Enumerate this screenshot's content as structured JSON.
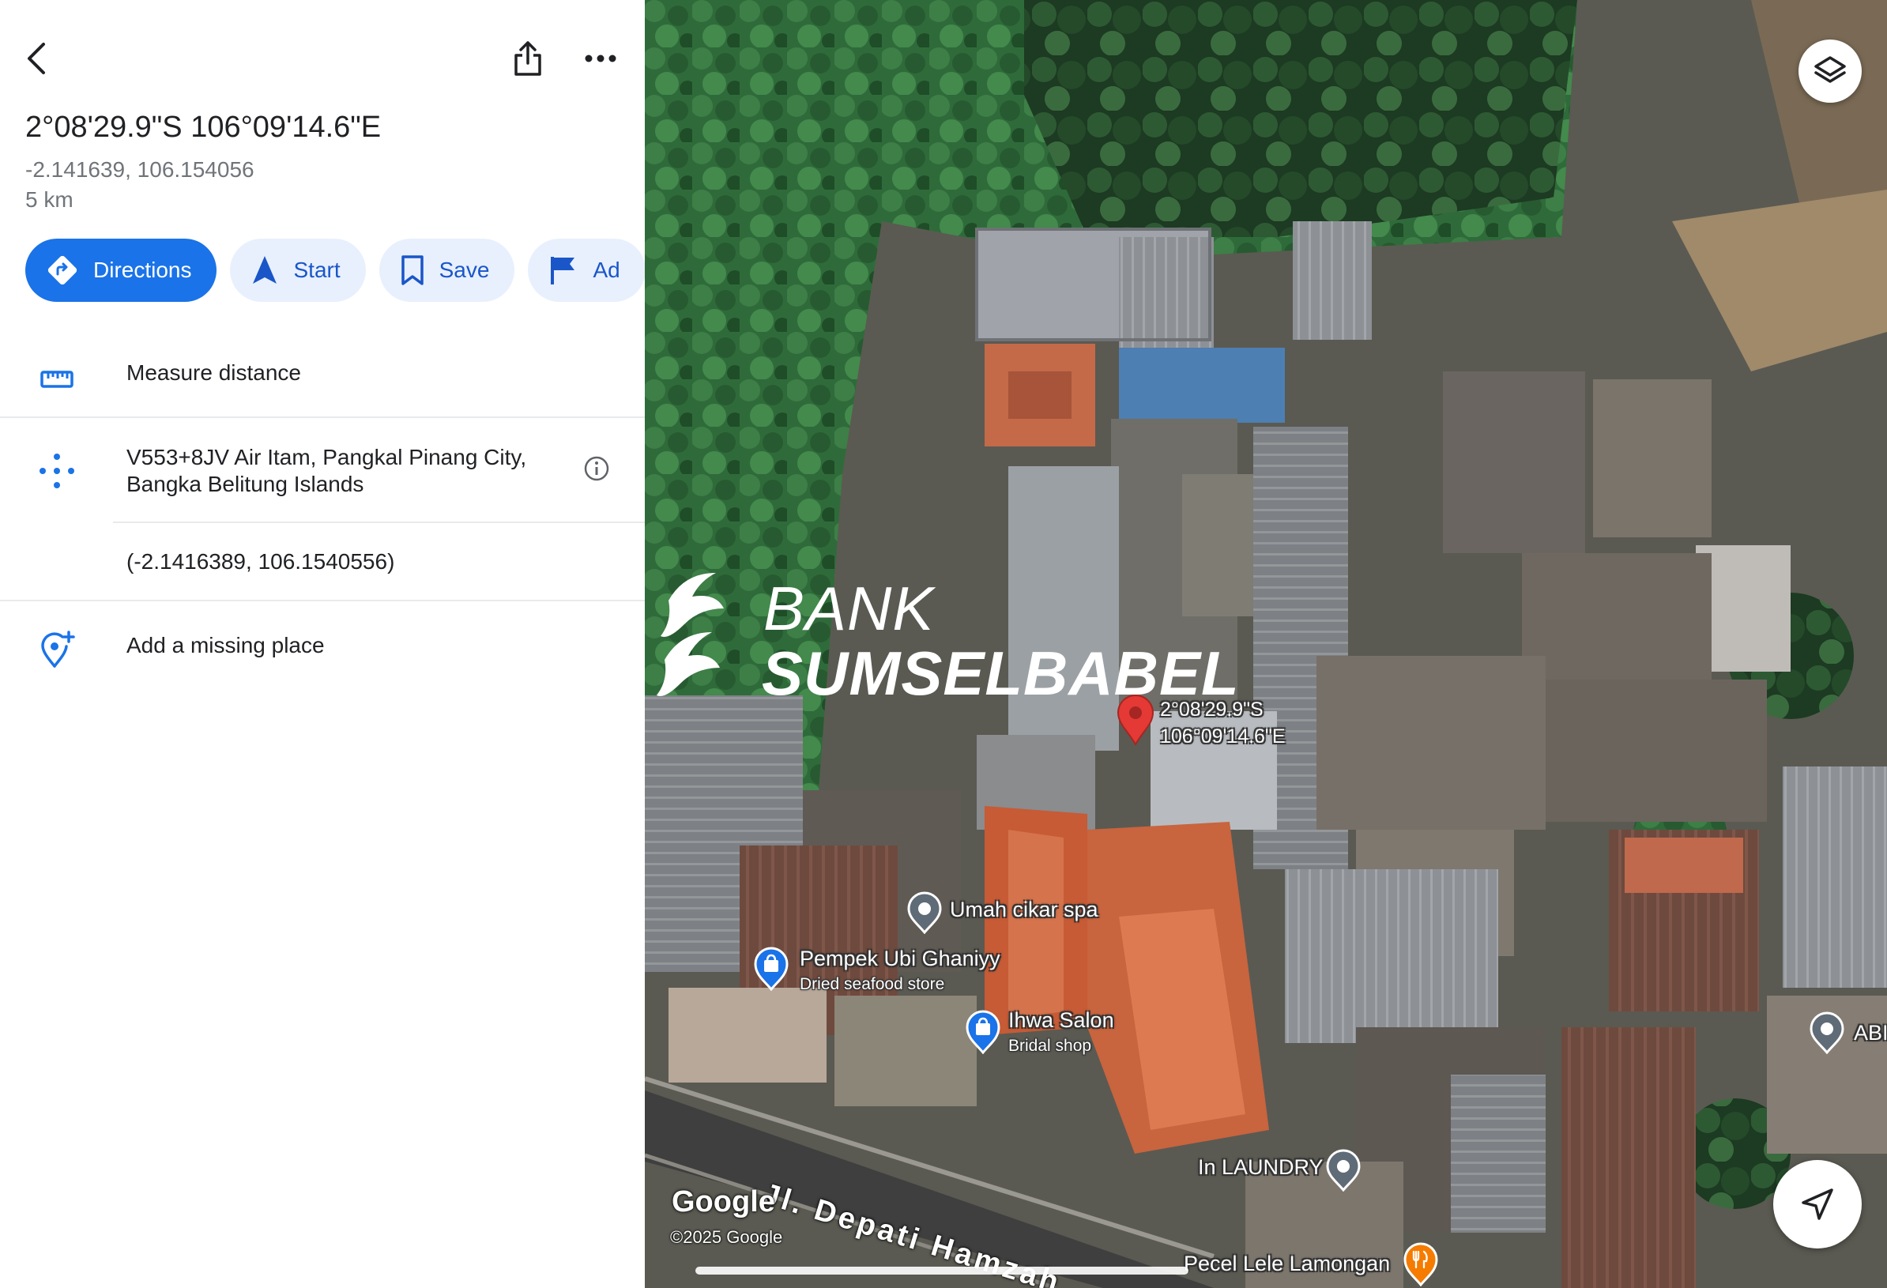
{
  "header": {
    "title": "2°08'29.9\"S 106°09'14.6\"E",
    "decimal_coords": "-2.141639, 106.154056",
    "distance": "5 km"
  },
  "actions": [
    {
      "label": "Directions",
      "icon": "directions-icon"
    },
    {
      "label": "Start",
      "icon": "navigation-arrow-icon"
    },
    {
      "label": "Save",
      "icon": "bookmark-icon"
    },
    {
      "label": "Ad",
      "icon": "flag-icon"
    }
  ],
  "rows": {
    "measure": {
      "label": "Measure distance",
      "icon": "ruler-icon"
    },
    "plus_code": {
      "address": "V553+8JV Air Itam, Pangkal Pinang City, Bangka Belitung Islands",
      "icon": "plus-code-icon"
    },
    "precise_coords": "(-2.1416389, 106.1540556)",
    "add_place": {
      "label": "Add a missing place",
      "icon": "add-location-icon"
    }
  },
  "map": {
    "watermark_line1": "BANK",
    "watermark_line2": "SUMSELBABEL",
    "pin_label_line1": "2°08'29.9\"S",
    "pin_label_line2": "106°09'14.6\"E",
    "places": [
      {
        "name": "Umah cikar spa",
        "category": "",
        "icon": "place-pin-icon"
      },
      {
        "name": "Pempek Ubi Ghaniyy",
        "category": "Dried seafood store",
        "icon": "shopping-bag-pin-icon"
      },
      {
        "name": "Ihwa Salon",
        "category": "Bridal shop",
        "icon": "shopping-bag-pin-icon"
      },
      {
        "name": "In LAUNDRY",
        "category": "",
        "icon": "place-pin-icon"
      },
      {
        "name": "Pecel Lele Lamongan",
        "category": "",
        "icon": "restaurant-pin-icon"
      },
      {
        "name": "ABI",
        "category": "",
        "icon": "place-pin-icon"
      }
    ],
    "road": "Jl. Depati Hamzah",
    "logo": "Google",
    "copyright": "©2025 Google"
  },
  "colors": {
    "primary_blue": "#1a73e8",
    "chip_bg": "#e8f0fe",
    "pin_red": "#e53935"
  }
}
